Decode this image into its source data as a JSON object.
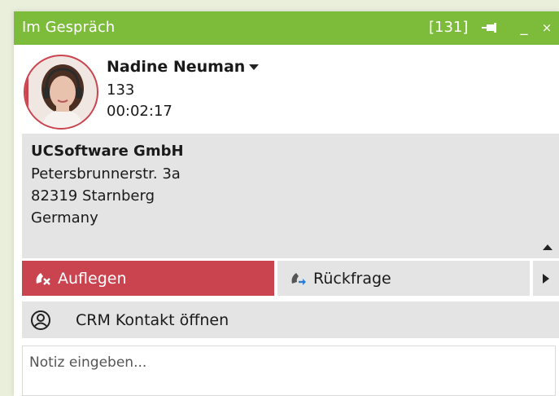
{
  "window": {
    "title": "Im Gespräch",
    "call_id": "[131]",
    "pin_icon": "pin-icon",
    "minimize_label": "_",
    "close_label": "×",
    "accent_color": "#7dbb3a"
  },
  "caller": {
    "name": "Nadine Neuman",
    "extension": "133",
    "duration": "00:02:17",
    "avatar_icon": "avatar-headset-photo"
  },
  "address": {
    "company": "UCSoftware GmbH",
    "street": "Petersbrunnerstr. 3a",
    "city": "82319 Starnberg",
    "country": "Germany"
  },
  "actions": {
    "hangup_label": "Auflegen",
    "hangup_color": "#c9444f",
    "consult_label": "Rückfrage",
    "more_icon": "triangle-right-icon"
  },
  "crm": {
    "label": "CRM Kontakt öffnen",
    "icon": "user-circle-icon"
  },
  "note": {
    "placeholder": "Notiz eingeben..."
  }
}
